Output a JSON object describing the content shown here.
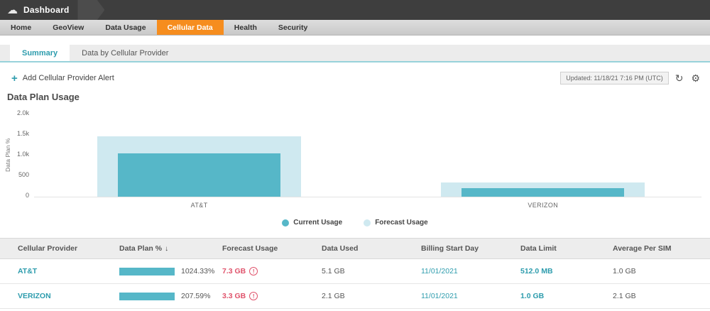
{
  "topbar": {
    "title": "Dashboard"
  },
  "icons": {
    "cloud": "☁",
    "plus": "+",
    "refresh": "↻",
    "gear": "⚙",
    "sort_desc": "↓",
    "warning": "!"
  },
  "nav": {
    "items": [
      {
        "label": "Home",
        "active": false
      },
      {
        "label": "GeoView",
        "active": false
      },
      {
        "label": "Data Usage",
        "active": false
      },
      {
        "label": "Cellular Data",
        "active": true
      },
      {
        "label": "Health",
        "active": false
      },
      {
        "label": "Security",
        "active": false
      }
    ]
  },
  "tabs": {
    "items": [
      {
        "label": "Summary",
        "active": true
      },
      {
        "label": "Data by Cellular Provider",
        "active": false
      }
    ]
  },
  "actions": {
    "add_alert_label": "Add Cellular Provider Alert",
    "updated_label": "Updated: 11/18/21 7:16 PM (UTC)"
  },
  "chart_data": {
    "type": "bar",
    "title": "Data Plan Usage",
    "ylabel": "Data Plan %",
    "categories": [
      "AT&T",
      "VERIZON"
    ],
    "series": [
      {
        "name": "Current Usage",
        "values": [
          1024.33,
          207.59
        ],
        "color": "#56b7c8"
      },
      {
        "name": "Forecast Usage",
        "values": [
          1425,
          330
        ],
        "color": "#cfe9f0"
      }
    ],
    "ylim": [
      0,
      2000
    ],
    "yticks": [
      "2.0k",
      "1.5k",
      "1.0k",
      "500",
      "0"
    ],
    "grid": false,
    "legend_position": "bottom"
  },
  "table": {
    "columns": [
      "Cellular Provider",
      "Data Plan %",
      "Forecast Usage",
      "Data Used",
      "Billing Start Day",
      "Data Limit",
      "Average Per SIM"
    ],
    "sorted_by": "Data Plan %",
    "sort_direction": "descending",
    "rows": [
      {
        "provider": "AT&T",
        "data_plan_pct": "1024.33%",
        "bar_fill": 100,
        "forecast": "7.3 GB",
        "data_used": "5.1 GB",
        "billing_start": "11/01/2021",
        "data_limit": "512.0 MB",
        "avg_per_sim": "1.0 GB"
      },
      {
        "provider": "VERIZON",
        "data_plan_pct": "207.59%",
        "bar_fill": 100,
        "forecast": "3.3 GB",
        "data_used": "2.1 GB",
        "billing_start": "11/01/2021",
        "data_limit": "1.0 GB",
        "avg_per_sim": "2.1 GB"
      }
    ]
  },
  "colors": {
    "accent_teal": "#2d9cad",
    "nav_active_orange": "#f68d1e",
    "alert_red": "#e0546c",
    "bar_current": "#56b7c8",
    "bar_forecast": "#cfe9f0"
  }
}
